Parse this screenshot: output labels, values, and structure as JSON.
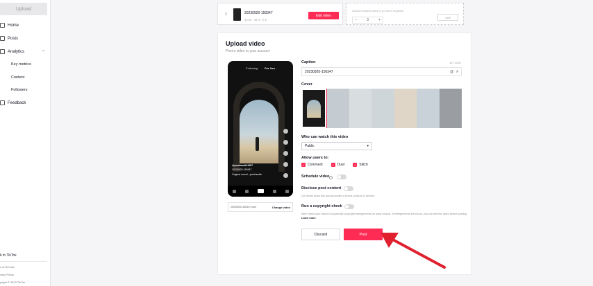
{
  "sidebar": {
    "upload_label": "Upload",
    "items": [
      {
        "label": "Home",
        "icon": "home-icon"
      },
      {
        "label": "Posts",
        "icon": "posts-icon"
      },
      {
        "label": "Analytics",
        "icon": "analytics-icon"
      }
    ],
    "analytics_sub": [
      "Key metrics",
      "Content",
      "Followers"
    ],
    "feedback_label": "Feedback",
    "footer": {
      "back": "k to TikTok",
      "terms": "s of Service",
      "privacy": "vacy Policy",
      "copyright": "yright © 2023 TikTok"
    }
  },
  "file_card": {
    "index": "1",
    "name": "20230920-150347",
    "meta": "00:30 · 48 % · 2.6",
    "edit_label": "Edit video"
  },
  "split_card": {
    "text": "Upload multiple parts in po-drum requests",
    "stepper_minus": "−",
    "stepper_value": "3",
    "stepper_plus": "+",
    "split_label": "Split"
  },
  "panel": {
    "title": "Upload video",
    "subtitle": "Post a video to your account"
  },
  "phone": {
    "tab_following": "Following",
    "tab_foryou": "For You",
    "username": "@yourhandle1997",
    "caption": "20230920-150347",
    "sound": "Original sound - yourhandle",
    "file_name": "20230920-150347.mp4",
    "change_label": "Change video"
  },
  "form": {
    "caption_label": "Caption",
    "caption_counter": "15 / 2200",
    "caption_value": "20230920-150347",
    "caption_icons": [
      "@",
      "#"
    ],
    "cover_label": "Cover",
    "visibility_label": "Who can watch this video",
    "visibility_value": "Public",
    "allow_label": "Allow users to:",
    "allow_options": [
      "Comment",
      "Duet",
      "Stitch"
    ],
    "schedule_label": "Schedule video",
    "disclose_label": "Disclose post content",
    "disclose_hint": "Let others know this post promotes a brand, product or service.",
    "copyright_label": "Run a copyright check",
    "copyright_hint": "We'll check your videos for potential copyright infringements on used sounds. If infringements are found, you can edit the video before posting.",
    "learn_more": "Learn more",
    "discard_label": "Discard",
    "post_label": "Post"
  },
  "colors": {
    "accent": "#fe2c55",
    "arrow": "#e0202e"
  }
}
